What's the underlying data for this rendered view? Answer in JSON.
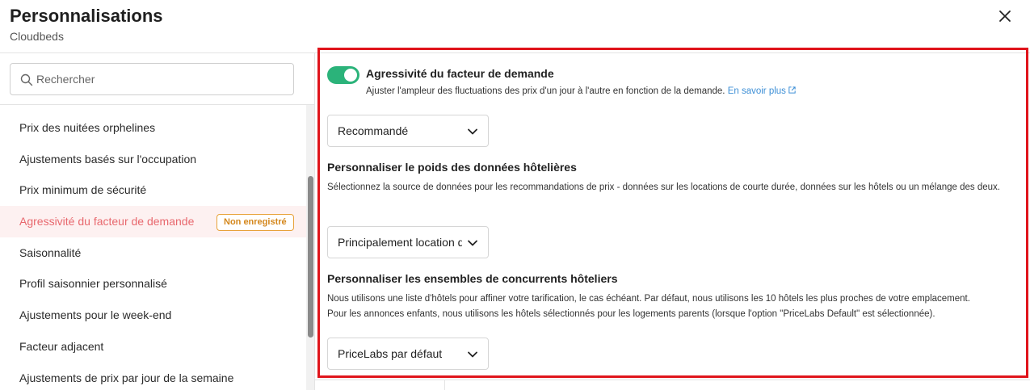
{
  "header": {
    "title": "Personnalisations",
    "subtitle": "Cloudbeds"
  },
  "search": {
    "placeholder": "Rechercher"
  },
  "sidebar": {
    "items": [
      {
        "label": "Prix des nuitées orphelines"
      },
      {
        "label": "Ajustements basés sur l'occupation"
      },
      {
        "label": "Prix minimum de sécurité"
      },
      {
        "label": "Agressivité du facteur de demande",
        "active": true,
        "badge": "Non enregistré"
      },
      {
        "label": "Saisonnalité"
      },
      {
        "label": "Profil saisonnier personnalisé"
      },
      {
        "label": "Ajustements pour le week-end"
      },
      {
        "label": "Facteur adjacent"
      },
      {
        "label": "Ajustements de prix par jour de la semaine"
      }
    ]
  },
  "main": {
    "toggle_on": true,
    "section1": {
      "title": "Agressivité du facteur de demande",
      "desc": "Ajuster l'ampleur des fluctuations des prix d'un jour à l'autre en fonction de la demande.",
      "link": "En savoir plus",
      "select_value": "Recommandé"
    },
    "section2": {
      "title": "Personnaliser le poids des données hôtelières",
      "desc": "Sélectionnez la source de données pour les recommandations de prix - données sur les locations de courte durée, données sur les hôtels ou un mélange des deux.",
      "select_value": "Principalement location de courte durée"
    },
    "section3": {
      "title": "Personnaliser les ensembles de concurrents hôteliers",
      "desc_line1": "Nous utilisons une liste d'hôtels pour affiner votre tarification, le cas échéant. Par défaut, nous utilisons les 10 hôtels les plus proches de votre emplacement.",
      "desc_line2": "Pour les annonces enfants, nous utilisons les hôtels sélectionnés pour les logements parents (lorsque l'option \"PriceLabs Default\" est sélectionnée).",
      "select_value": "PriceLabs par défaut"
    }
  },
  "colors": {
    "accent_active": "#e8686e",
    "toggle_green": "#2bb37a",
    "badge_orange": "#d4871c",
    "highlight_red": "#e0141b",
    "link_blue": "#3d8fd6"
  }
}
